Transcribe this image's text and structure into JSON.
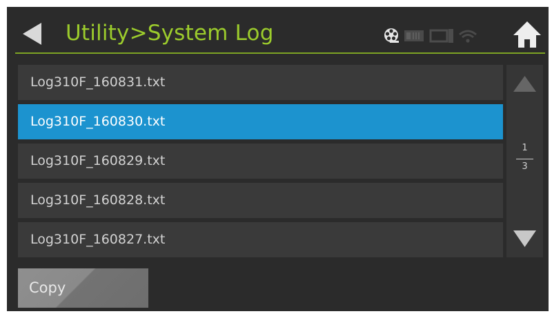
{
  "header": {
    "title": "Utility>System Log",
    "back_icon": "back-arrow-icon",
    "home_icon": "home-icon",
    "status_icons": [
      "film-reel-icon",
      "card-icon",
      "monitor-icon",
      "wifi-icon"
    ]
  },
  "log_list": {
    "items": [
      {
        "label": "Log310F_160831.txt",
        "selected": false
      },
      {
        "label": "Log310F_160830.txt",
        "selected": true
      },
      {
        "label": "Log310F_160829.txt",
        "selected": false
      },
      {
        "label": "Log310F_160828.txt",
        "selected": false
      },
      {
        "label": "Log310F_160827.txt",
        "selected": false
      }
    ]
  },
  "pagination": {
    "current": "1",
    "total": "3",
    "up_icon": "scroll-up-icon",
    "down_icon": "scroll-down-icon"
  },
  "actions": {
    "copy_label": "Copy"
  },
  "colors": {
    "accent": "#9ccc2c",
    "selected": "#1c93cf",
    "background": "#2b2b2b",
    "row": "#3a3a3a"
  }
}
